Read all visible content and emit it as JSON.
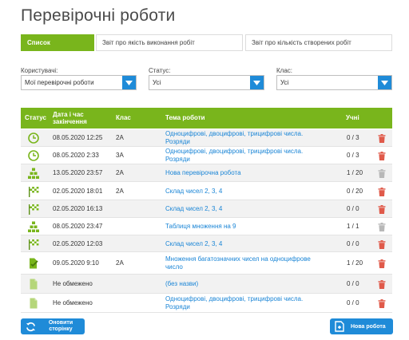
{
  "page": {
    "title": "Перевірочні роботи"
  },
  "tabs": [
    {
      "label": "Список",
      "active": true
    },
    {
      "label": "Звіт про якість виконання робіт",
      "active": false
    },
    {
      "label": "Звіт про кількість створених робіт",
      "active": false
    }
  ],
  "filters": {
    "users": {
      "label": "Користувачі:",
      "value": "Мої перевірочні роботи"
    },
    "status": {
      "label": "Статус:",
      "value": "Усі"
    },
    "class": {
      "label": "Клас:",
      "value": "Усі"
    }
  },
  "table": {
    "headers": {
      "status": "Статус",
      "datetime": "Дата і час закінчення",
      "class": "Клас",
      "topic": "Тема роботи",
      "students": "Учні"
    },
    "rows": [
      {
        "status_icon": "clock-icon",
        "datetime": "08.05.2020 12:25",
        "class": "2А",
        "topic": "Одноцифрові, двоцифрові, трицифрові числа. Розряди",
        "students": "0 / 3",
        "trash_active": true
      },
      {
        "status_icon": "clock-icon",
        "datetime": "08.05.2020 2:33",
        "class": "3А",
        "topic": "Одноцифрові, двоцифрові, трицифрові числа. Розряди",
        "students": "0 / 3",
        "trash_active": true
      },
      {
        "status_icon": "hierarchy-icon",
        "datetime": "13.05.2020 23:57",
        "class": "2А",
        "topic": "Нова перевірочна робота",
        "students": "1 / 20",
        "trash_active": false
      },
      {
        "status_icon": "finish-flag-icon",
        "datetime": "02.05.2020 18:01",
        "class": "2А",
        "topic": "Склад чисел 2, 3, 4",
        "students": "0 / 20",
        "trash_active": true
      },
      {
        "status_icon": "finish-flag-icon",
        "datetime": "02.05.2020 16:13",
        "class": "",
        "topic": "Склад чисел 2, 3, 4",
        "students": "0 / 0",
        "trash_active": true
      },
      {
        "status_icon": "hierarchy-icon",
        "datetime": "08.05.2020 23:47",
        "class": "",
        "topic": "Таблиця множення на 9",
        "students": "1 / 1",
        "trash_active": false
      },
      {
        "status_icon": "finish-flag-icon",
        "datetime": "02.05.2020 12:03",
        "class": "",
        "topic": "Склад чисел 2, 3, 4",
        "students": "0 / 0",
        "trash_active": true
      },
      {
        "status_icon": "document-check-icon",
        "datetime": "09.05.2020 9:10",
        "class": "2А",
        "topic": "Множення багатозначних чисел на одноцифрове число",
        "students": "1 / 20",
        "trash_active": true
      },
      {
        "status_icon": "document-icon",
        "datetime": "Не обмежено",
        "class": "",
        "topic": "(без назви)",
        "students": "0 / 0",
        "trash_active": true
      },
      {
        "status_icon": "document-icon",
        "datetime": "Не обмежено",
        "class": "",
        "topic": "Одноцифрові, двоцифрові, трицифрові числа. Розряди",
        "students": "0 / 0",
        "trash_active": true
      }
    ]
  },
  "buttons": {
    "refresh": {
      "label": "Оновити сторінку",
      "icon": "refresh-icon"
    },
    "new_work": {
      "label": "Нова робота",
      "icon": "new-document-icon"
    }
  },
  "colors": {
    "accent_green": "#79b51c",
    "accent_blue": "#1f8bd8",
    "link_blue": "#1a85d6",
    "trash_red": "#e05a4a",
    "trash_gray": "#b8b8b8"
  }
}
